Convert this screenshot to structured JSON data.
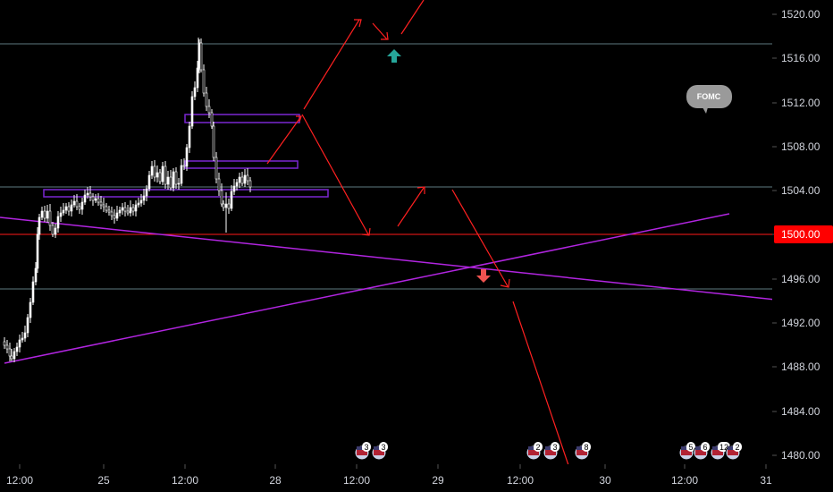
{
  "chart_data": {
    "type": "candlestick",
    "price_axis": {
      "ticks": [
        "1520.00",
        "1516.00",
        "1512.00",
        "1508.00",
        "1504.00",
        "1500.00",
        "1496.00",
        "1492.00",
        "1488.00",
        "1484.00",
        "1480.00"
      ],
      "current_price_tag": "1500.00"
    },
    "time_axis": {
      "ticks": [
        "12:00",
        "25",
        "12:00",
        "28",
        "12:00",
        "29",
        "12:00",
        "30",
        "12:00",
        "31"
      ]
    },
    "event_note": "FOMC",
    "event_markers": [
      {
        "label": "3"
      },
      {
        "label": "3"
      },
      {
        "label": "2"
      },
      {
        "label": "3"
      },
      {
        "label": "8"
      },
      {
        "label": "5"
      },
      {
        "label": "6"
      },
      {
        "label": "12"
      },
      {
        "label": "2"
      }
    ],
    "horizontal_levels": [
      1517.3,
      1504.5,
      1500.0,
      1495.0
    ],
    "colors": {
      "background": "#000000",
      "candle": "#ffffff",
      "level_line": "#5e7a80",
      "current_price": "#ff0000",
      "trendline": "#b125e0",
      "zone": "#7a27d1",
      "projection": "#ff0000",
      "arrow_up": "#26a69a",
      "arrow_down": "#ef5350"
    }
  }
}
